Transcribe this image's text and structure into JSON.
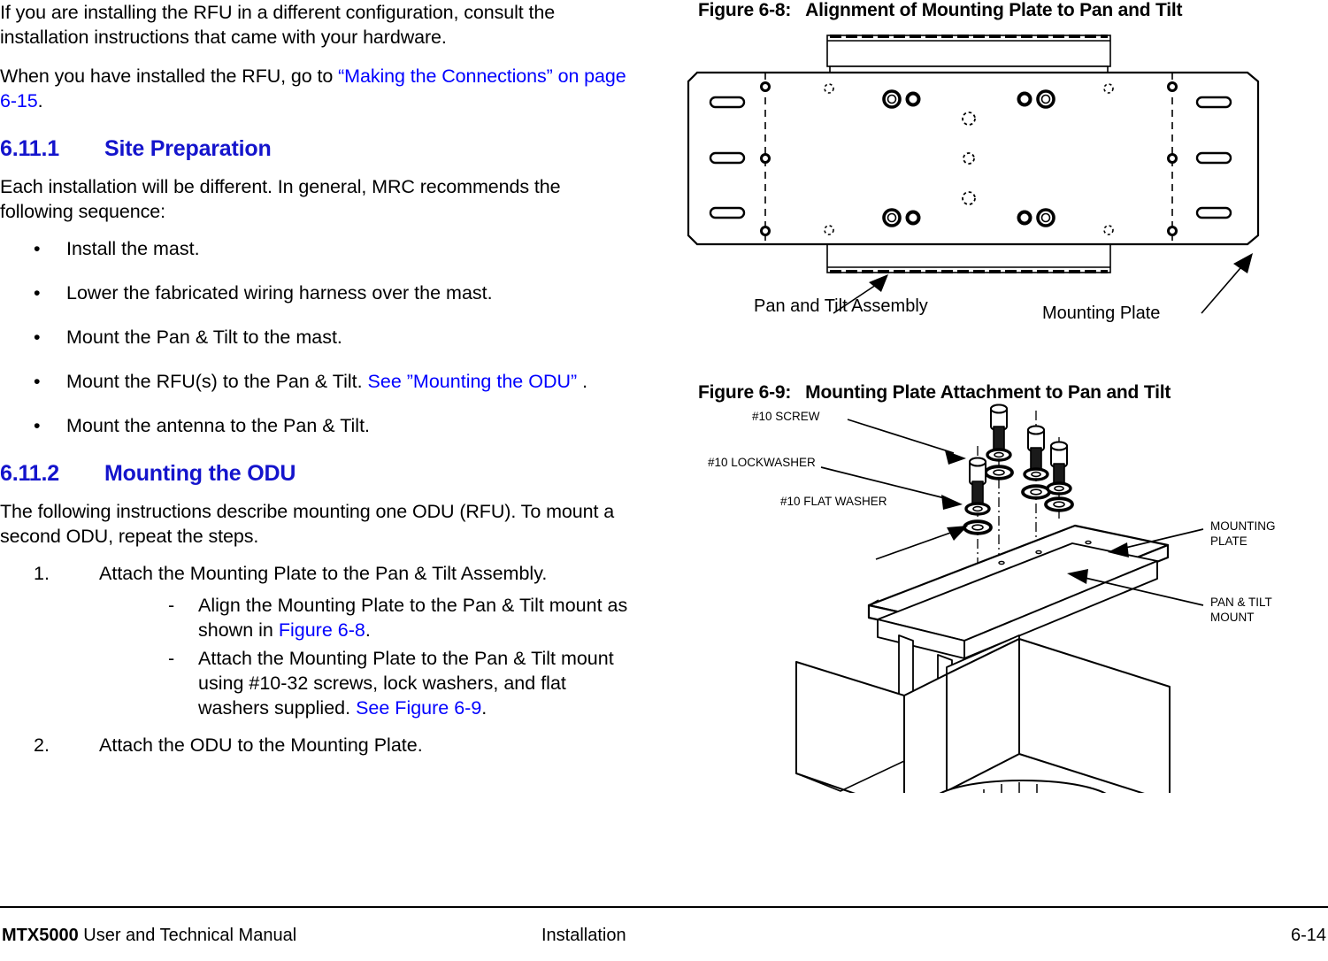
{
  "document": {
    "footer_left_bold": "MTX5000",
    "footer_left_rest": " User and Technical Manual",
    "footer_center": "Installation",
    "footer_page": "6-14"
  },
  "colors": {
    "link": "#0000FF",
    "heading": "#1414CC",
    "text": "#000000",
    "line": "#000000"
  },
  "left_column": {
    "para1": "If you are installing the RFU in a different configuration, consult the installation instructions that came with your hardware.",
    "para2_prefix": "When you have installed the RFU, go to ",
    "para2_link": "“Making the Connections” on page 6-15",
    "para2_suffix": ".",
    "section1": {
      "number": "6.11.1",
      "title": "Site Preparation",
      "intro": "Each installation will be different.  In general, MRC recommends the following sequence:",
      "bullet_char": "•",
      "bullets": [
        {
          "text": "Install the mast.",
          "link": "",
          "tail": ""
        },
        {
          "text": "Lower the fabricated wiring harness over the mast.",
          "link": "",
          "tail": ""
        },
        {
          "text": "Mount the Pan & Tilt to the mast.",
          "link": "",
          "tail": ""
        },
        {
          "text": "Mount the RFU(s) to the Pan & Tilt.  ",
          "link": "See ”Mounting the ODU”",
          "tail": " ."
        },
        {
          "text": "Mount the antenna to the Pan & Tilt.",
          "link": "",
          "tail": ""
        }
      ]
    },
    "section2": {
      "number": "6.11.2",
      "title": "Mounting the ODU",
      "intro": "The following instructions describe mounting one ODU (RFU). To mount a second ODU, repeat the steps.",
      "dash_char": "-",
      "steps": [
        {
          "number": "1.",
          "text": "Attach the Mounting Plate to the Pan & Tilt Assembly.",
          "substeps": [
            {
              "prefix": "Align the Mounting Plate to the Pan & Tilt mount as shown in ",
              "link": "Figure 6-8",
              "suffix": "."
            },
            {
              "prefix": "Attach the Mounting Plate to the Pan & Tilt mount using #10-32 screws, lock washers, and flat washers supplied.  ",
              "link": "See Figure 6-9",
              "suffix": "."
            }
          ]
        },
        {
          "number": "2.",
          "text": "Attach the ODU to the Mounting Plate.",
          "substeps": []
        }
      ]
    }
  },
  "right_column": {
    "figure_6_8": {
      "caption_number": "Figure 6-8:",
      "caption_title": "Alignment of Mounting Plate to Pan and Tilt",
      "labels": [
        {
          "text": "Pan and Tilt Assembly"
        },
        {
          "text": "Mounting Plate"
        }
      ]
    },
    "figure_6_9": {
      "caption_number": "Figure 6-9:",
      "caption_title": "Mounting Plate Attachment to Pan and Tilt",
      "callouts": [
        {
          "text": "#10 SCREW"
        },
        {
          "text": "#10 LOCKWASHER"
        },
        {
          "text": "#10 FLAT WASHER"
        },
        {
          "text": "MOUNTING\nPLATE"
        },
        {
          "text": "PAN & TILT\nMOUNT"
        }
      ]
    }
  }
}
